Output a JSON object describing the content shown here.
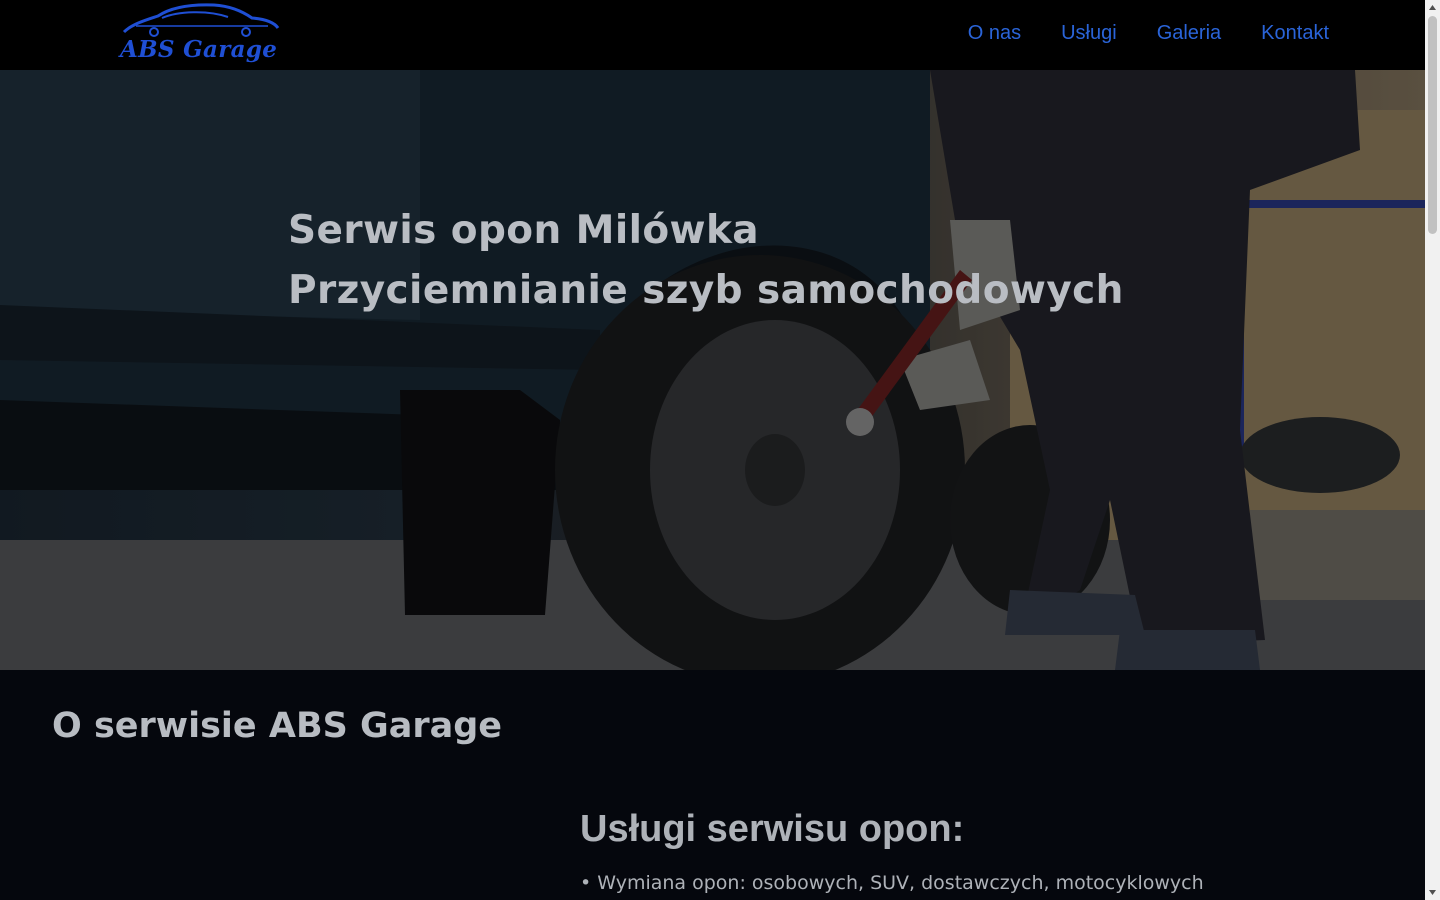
{
  "nav": {
    "logo_text": "ABS Garage",
    "links": [
      "O nas",
      "Usługi",
      "Galeria",
      "Kontakt"
    ]
  },
  "hero": {
    "line1": "Serwis opon Milówka",
    "line2": "Przyciemnianie szyb samochodowych"
  },
  "about": {
    "title": "O serwisie ABS Garage"
  },
  "services": {
    "title": "Usługi serwisu opon:",
    "items": [
      "• Wymiana opon: osobowych, SUV, dostawczych, motocyklowych"
    ]
  },
  "colors": {
    "nav_bg": "#000000",
    "accent": "#2a64d8",
    "section_bg": "#05070d"
  }
}
